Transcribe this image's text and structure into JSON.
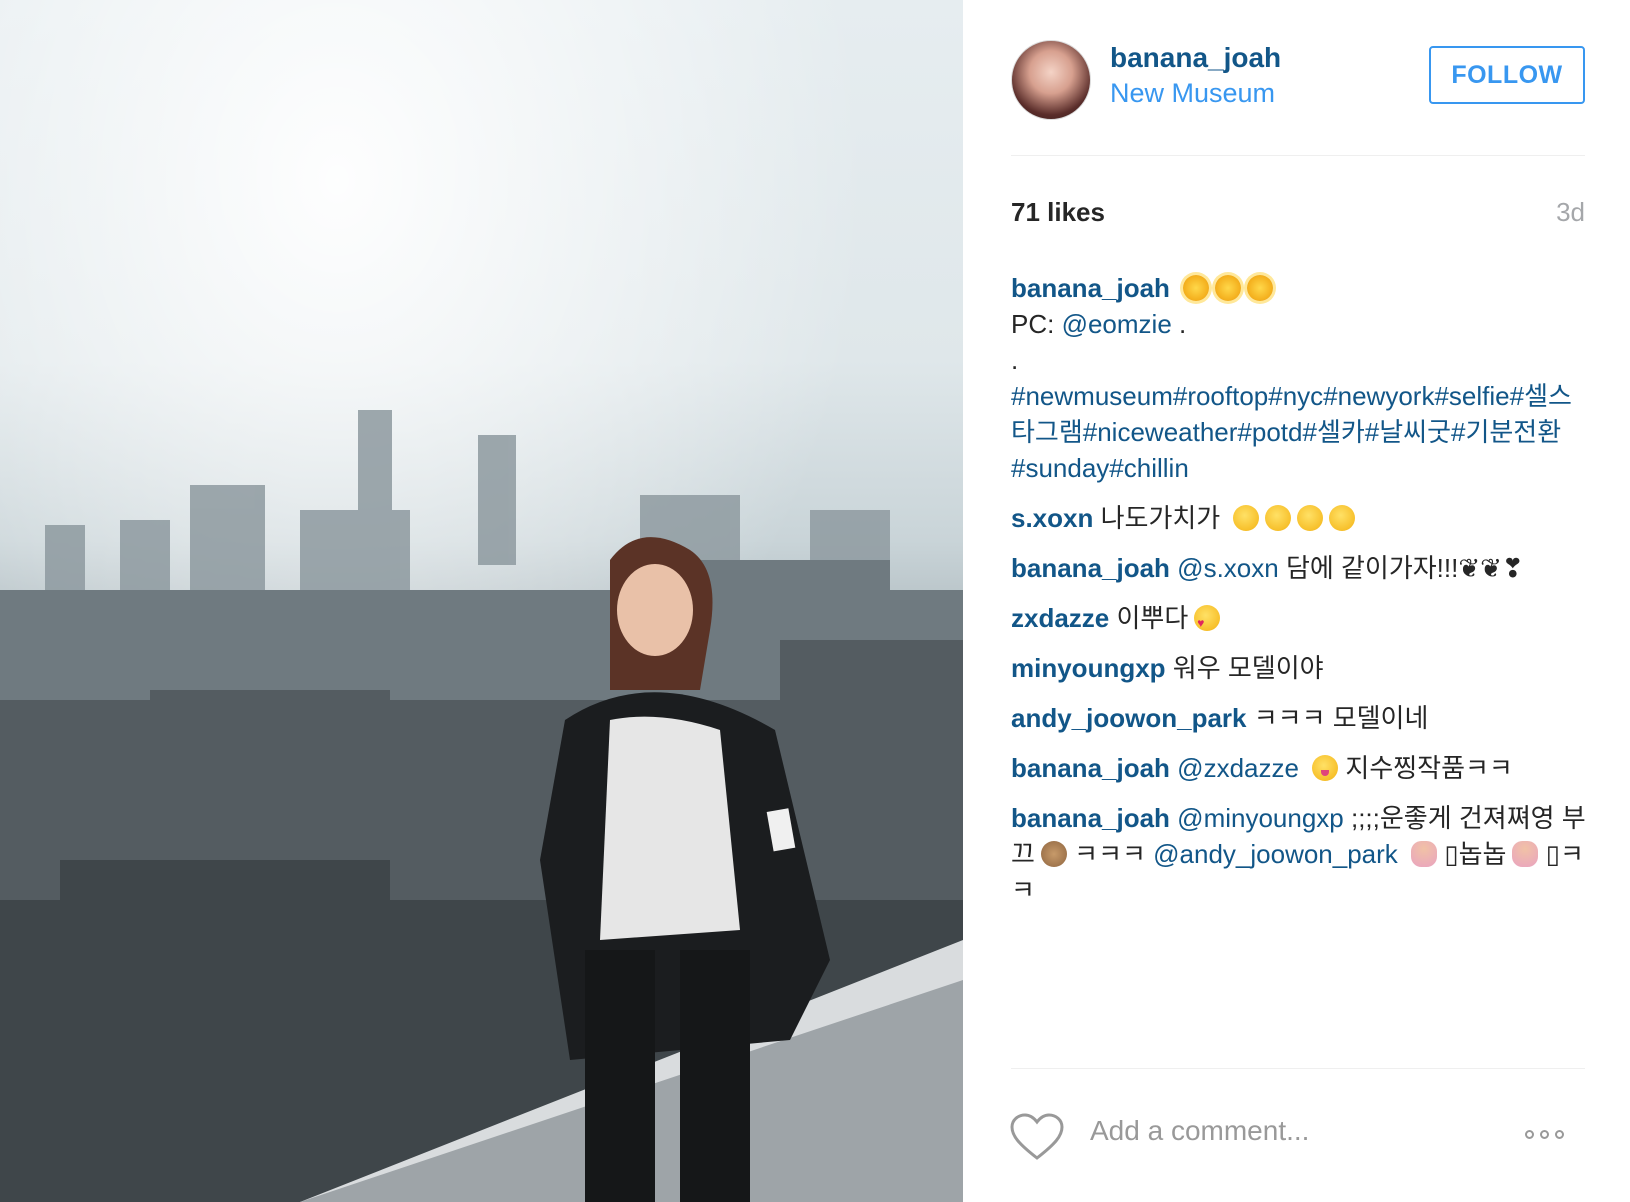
{
  "post": {
    "owner": "banana_joah",
    "location": "New Museum",
    "follow_label": "FOLLOW",
    "likes": "71 likes",
    "age": "3d"
  },
  "caption": {
    "user": "banana_joah",
    "pc_prefix": "PC: ",
    "pc_mention": "@eomzie",
    "pc_suffix": " .",
    "dot": ".",
    "hashtags": "#newmuseum#rooftop#nyc#newyork#selfie#셀스타그램#niceweather#potd#셀카#날씨굿#기분전환#sunday#chillin"
  },
  "comments": [
    {
      "user": "s.xoxn",
      "text": "나도가치가"
    },
    {
      "user": "banana_joah",
      "mention": "@s.xoxn",
      "text": " 담에 같이가자!!!❦❦❣"
    },
    {
      "user": "zxdazze",
      "text": "이뿌다"
    },
    {
      "user": "minyoungxp",
      "text": "워우 모델이야"
    },
    {
      "user": "andy_joowon_park",
      "text": "ㅋㅋㅋ 모델이네"
    },
    {
      "user": "banana_joah",
      "mention": "@zxdazze",
      "text": " 지수찡작품ㅋㅋ"
    },
    {
      "user": "banana_joah",
      "mention": "@minyoungxp",
      "text": " ;;;;운좋게 건져쪄영 부끄",
      "text2": " ㅋㅋㅋ ",
      "mention2": "@andy_joowon_park",
      "text3": " ▯놉놉",
      "text4": " ▯ㅋㅋ"
    }
  ],
  "add_comment": {
    "placeholder": "Add a comment..."
  },
  "icons": {
    "like": "heart-outline-icon",
    "more": "more-options-icon"
  },
  "colors": {
    "username": "#125688",
    "link_blue": "#3897f0",
    "muted": "#a5a7aa"
  }
}
